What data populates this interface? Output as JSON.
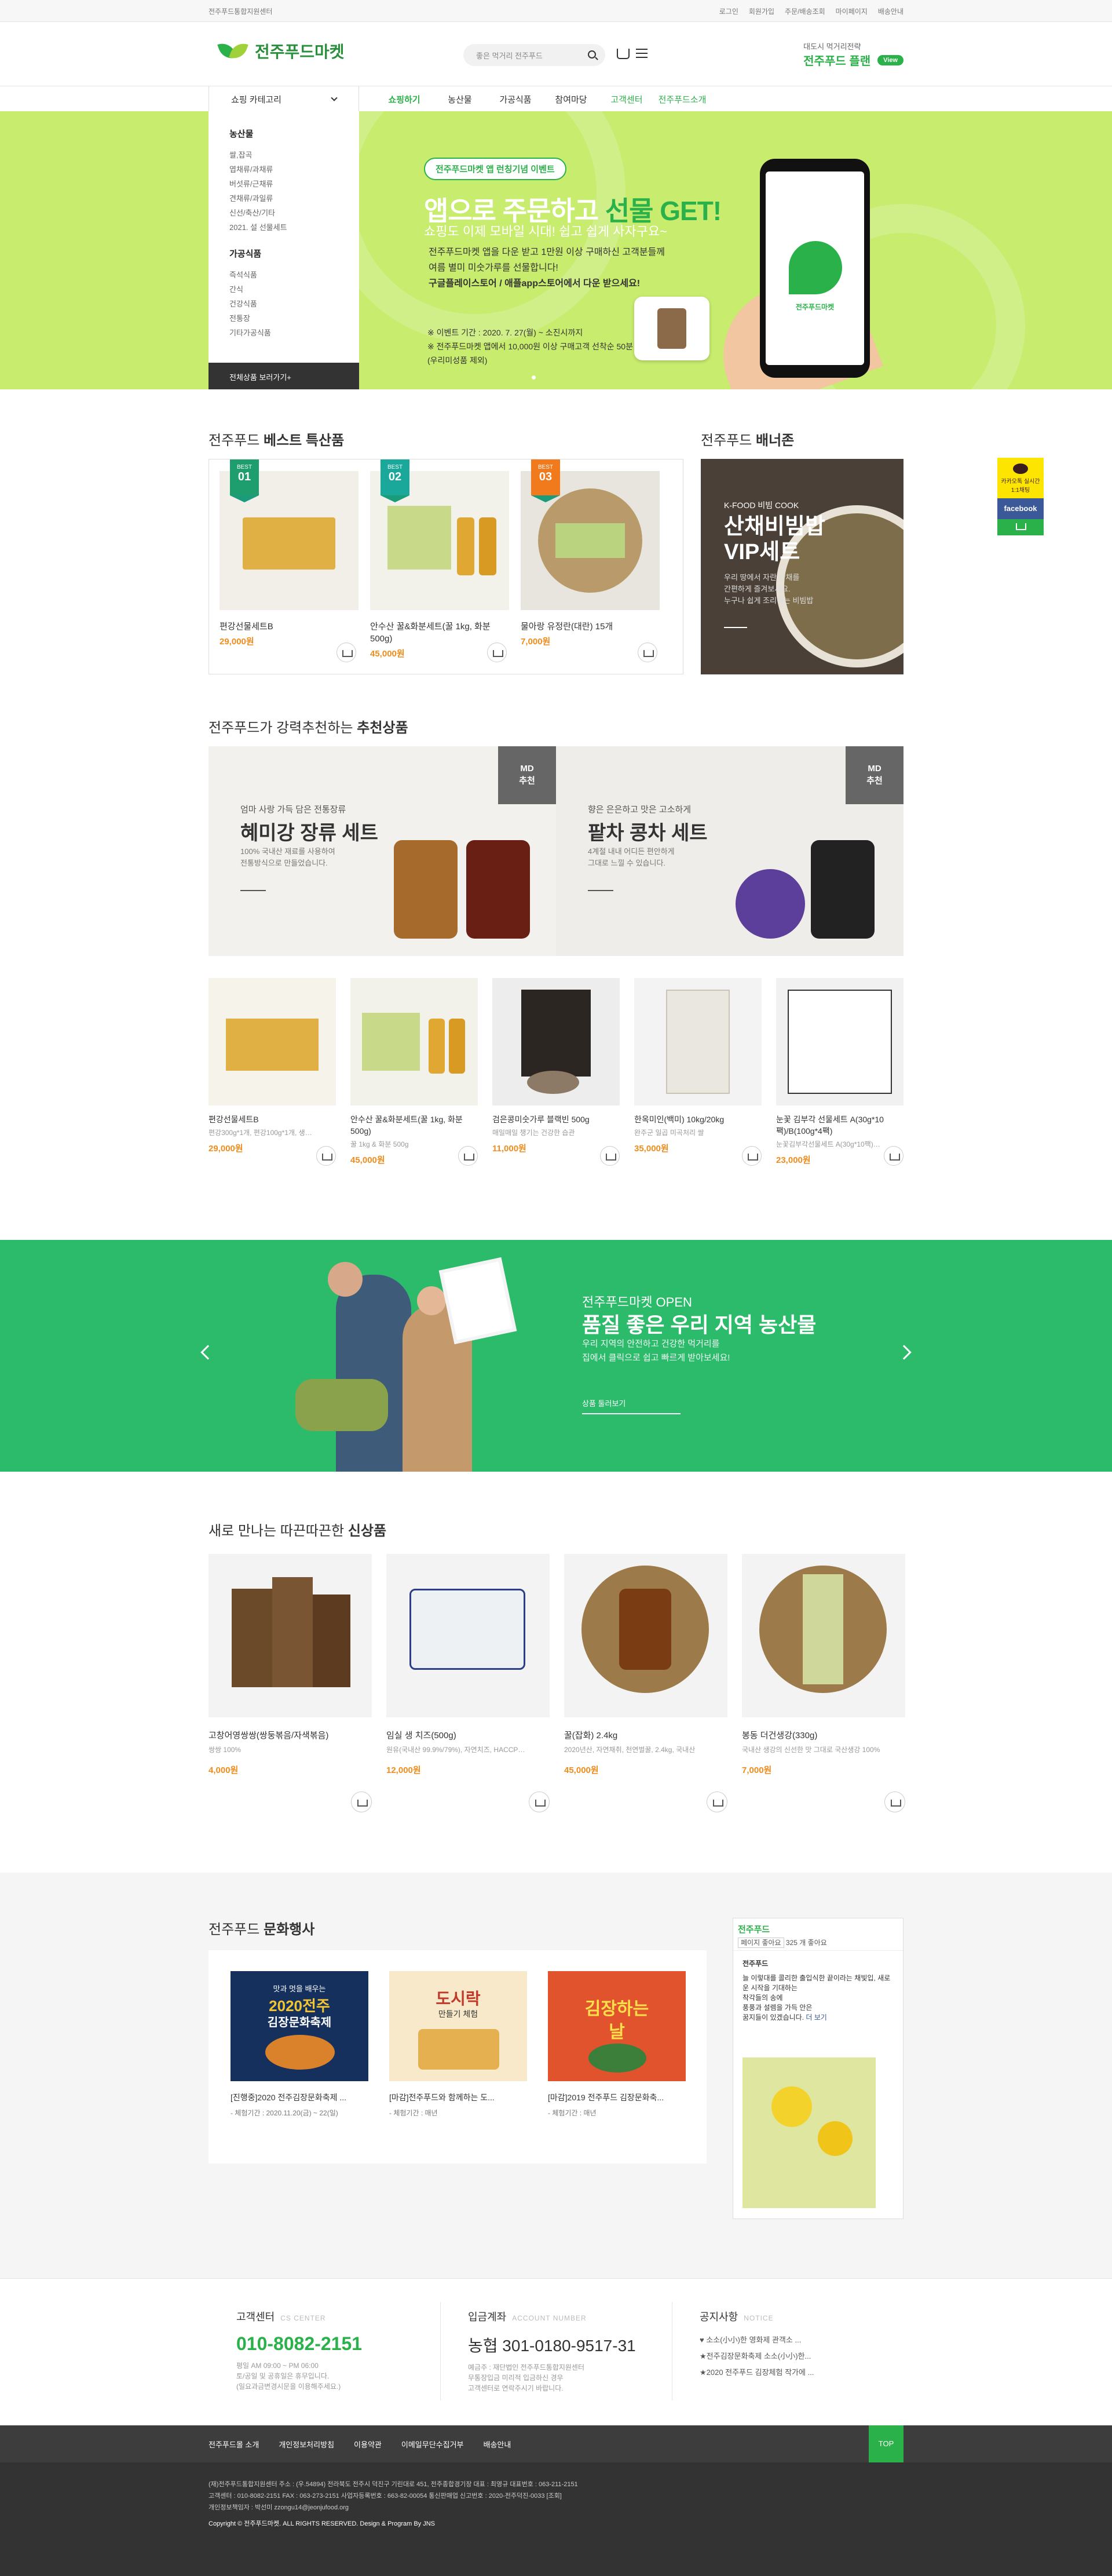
{
  "topbar": {
    "site_label": "전주푸드통합지원센터",
    "links": [
      "로그인",
      "회원가입",
      "주문/배송조회",
      "마이페이지",
      "배송안내"
    ]
  },
  "header": {
    "logo_text": "전주푸드마켓",
    "search_placeholder": "좋은 먹거리 전주푸드",
    "plan_small": "대도시 먹거리전략",
    "plan_big": "전주푸드 플랜",
    "plan_view": "View"
  },
  "gnb": {
    "category_button": "쇼핑 카테고리",
    "menu": [
      "쇼핑하기",
      "농산물",
      "가공식품",
      "참여마당",
      "고객센터",
      "전주푸드소개"
    ]
  },
  "category_panel": {
    "group1_title": "농산물",
    "group1_items": [
      "쌀,잡곡",
      "엽채류/과채류",
      "버섯류/근채류",
      "견채류/과일류",
      "신선/축산/기타",
      "2021. 설 선물세트"
    ],
    "group2_title": "가공식품",
    "group2_items": [
      "즉석식품",
      "간식",
      "건강식품",
      "전통장",
      "기타가공식품"
    ],
    "all_link": "전체상품 보러가기+"
  },
  "hero": {
    "badge": "전주푸드마켓 앱 런칭기념 이벤트",
    "title_a": "앱으로 주문하고",
    "title_b": "선물 GET!",
    "subtitle": "쇼핑도 이제 모바일 시대! 쉽고 쉽게 사자구요~",
    "body_1": "전주푸드마켓 앱을 다운 받고 1만원 이상 구매하신 고객분들께",
    "body_2": "여름 별미 미숫가루를 선물합니다!",
    "body_3": "구글플레이스토어 / 애플app스토어에서 다운 받으세요!",
    "note_1": "※ 이벤트 기간 : 2020. 7. 27(월) ~ 소진시까지",
    "note_2": "※ 전주푸드마켓 앱에서 10,000원 이상 구매고객 선착순 50분 한정",
    "note_3": "(우리미성품 제외)",
    "phone_brand": "전주푸드마켓"
  },
  "best": {
    "title_a": "전주푸드",
    "title_b": "베스트 특산품",
    "items": [
      {
        "rank_label": "BEST",
        "rank": "01",
        "name": "편강선물세트B",
        "price": "29,000원"
      },
      {
        "rank_label": "BEST",
        "rank": "02",
        "name": "안수산 꿀&화분세트(꿀 1kg, 화분 500g)",
        "price": "45,000원"
      },
      {
        "rank_label": "BEST",
        "rank": "03",
        "name": "물아랑 유정란(대란) 15개",
        "price": "7,000원"
      }
    ]
  },
  "banner_zone": {
    "title_a": "전주푸드",
    "title_b": "배너존",
    "small": "K-FOOD 비빔 COOK",
    "big_1": "산채비빔밥",
    "big_2": "VIP세트",
    "desc_1": "우리 땅에서 자란 산채를",
    "desc_2": "간편하게 즐겨보세요.",
    "desc_3": "누구나 쉽게 조리하는 비빔밥"
  },
  "recommend": {
    "title_a": "전주푸드가 강력추천하는",
    "title_b": "추천상품",
    "md": [
      {
        "tag_1": "MD",
        "tag_2": "추천",
        "small": "엄마 사랑 가득 담은 전통장류",
        "title": "혜미강 장류 세트",
        "desc_1": "100% 국내산 재료를 사용하여",
        "desc_2": "전통방식으로 만들었습니다."
      },
      {
        "tag_1": "MD",
        "tag_2": "추천",
        "small": "향은 은은하고 맛은 고소하게",
        "title": "팥차 콩차 세트",
        "desc_1": "4계절 내내 어디든 편안하게",
        "desc_2": "그대로 느낄 수 있습니다."
      }
    ],
    "items": [
      {
        "name": "편강선물세트B",
        "desc": "편강300g*1개, 편강100g*1개, 생강...",
        "price": "29,000원"
      },
      {
        "name": "안수산 꿀&화분세트(꿀 1kg, 화분 500g)",
        "desc": "꿀 1kg & 화분 500g",
        "price": "45,000원"
      },
      {
        "name": "검은콩미숫가루 블랙빈 500g",
        "desc": "매일매일 챙기는 건강한 습관",
        "price": "11,000원"
      },
      {
        "name": "한옥미인(백미) 10kg/20kg",
        "desc": "완주군 일곱 미곡처리 쌀",
        "price": "35,000원"
      },
      {
        "name": "눈꽃 김부각 선물세트 A(30g*10팩)/B(100g*4팩)",
        "desc": "눈꽃김부각선물세트 A(30g*10팩) / ...",
        "price": "23,000원"
      }
    ]
  },
  "green_banner": {
    "t1": "전주푸드마켓 OPEN",
    "t2": "품질 좋은 우리 지역 농산물",
    "t3a": "우리 지역의 안전하고 건강한 먹거리를",
    "t3b": "집에서 클릭으로 쉽고 빠르게 받아보세요!",
    "button": "상품 둘러보기"
  },
  "new_items": {
    "title_a": "새로 만나는 따끈따끈한",
    "title_b": "신상품",
    "items": [
      {
        "name": "고창어영쌍쌍(쌍둥볶음/자색볶음)",
        "desc": "쌍쌍 100%",
        "price": "4,000원"
      },
      {
        "name": "임실 생 치즈(500g)",
        "desc": "원유(국내산 99.9%/79%), 자연치즈, HACCP인증...",
        "price": "12,000원"
      },
      {
        "name": "꿀(잡화) 2.4kg",
        "desc": "2020년산, 자연채취, 천연벌꿀, 2.4kg, 국내산",
        "price": "45,000원"
      },
      {
        "name": "봉동 더건생강(330g)",
        "desc": "국내산 생강의 신선한 맛 그대로 국산생강 100%",
        "price": "7,000원"
      }
    ]
  },
  "culture": {
    "title_a": "전주푸드",
    "title_b": "문화행사",
    "items": [
      {
        "poster_1": "맛과 멋을 배우는",
        "poster_2": "2020전주",
        "poster_3": "김장문화축제",
        "name": "[진행중]2020 전주김장문화축제 ...",
        "date": "- 체험기간 : 2020.11.20(금) ~ 22(일)"
      },
      {
        "poster_1": "도시락",
        "poster_2": "만들기 체험",
        "poster_3": "",
        "name": "[마감]전주푸드와 함께하는 도...",
        "date": "- 체험기간 : 매년"
      },
      {
        "poster_1": "김장하는",
        "poster_2": "날",
        "poster_3": "",
        "name": "[마감]2019 전주푸드 김장문화축...",
        "date": "- 체험기간 : 매년"
      }
    ]
  },
  "facebook": {
    "page_name": "전주푸드",
    "like": "페이지 좋아요",
    "likes_count": "325 개 좋아요",
    "post_name": "전주푸드",
    "post_1": "늘 이렇대를 콜리한 출입식한 끝이라는 채빛입, 새로운 시작을 기대하는",
    "post_2": "착각들의 송에",
    "post_3": "풍풍과 설렘을 가득 안은",
    "post_4": "꿈지들이 있겠습니다.",
    "more": "더 보기"
  },
  "footer_info": {
    "cs_title": "고객센터",
    "cs_en": "CS CENTER",
    "cs_phone": "010-8082-2151",
    "cs_hours": "평일 AM 09:00 ~ PM 06:00",
    "cs_note_1": "토/공일 및 공휴일은 휴무입니다.",
    "cs_note_2": "(일요과금변경시문을 이용해주세요.)",
    "bank_title": "입금계좌",
    "bank_en": "ACCOUNT NUMBER",
    "bank_number": "농협 301-0180-9517-31",
    "bank_note_1": "예금주 : 재단법인 전주푸드통합지원센터",
    "bank_note_2": "무통장입금 미리적 입금하신 경우",
    "bank_note_3": "고객센터로 연락주시기 바랍니다.",
    "notice_title": "공지사항",
    "notice_en": "NOTICE",
    "notices": [
      "♥ 소소(小小)한 영화제 관객소 ...",
      "★전주김장문화축제 소소(小小)한...",
      "★2020 전주푸드 김장체험 작가에 ..."
    ]
  },
  "footer_nav": {
    "links": [
      "전주푸드몰 소개",
      "개인정보처리방침",
      "이용약관",
      "이메일무단수집거부",
      "배송안내"
    ],
    "top": "TOP"
  },
  "footer_bottom": {
    "line_1": "(재)전주푸드통합지원센터    주소 : (우.54894) 전라북도 전주시 덕진구 기린대로 451, 전주종합경기장    대표 : 최영규    대표번호 : 063-211-2151",
    "line_2": "고객센터 : 010-8082-2151    FAX : 063-273-2151    사업자등록번호 : 663-82-00054    통신판매업 신고번호 : 2020-전주덕진-0033 [조회]",
    "line_3": "개인정보책임자 : 박선미    zzongu14@jeonjufood.org",
    "copyright": "Copyright © 전주푸드마켓. ALL RIGHTS RESERVED. Design & Program By JNS"
  },
  "quick": {
    "kakao": "카카오톡 실시간 1:1채팅",
    "facebook": "facebook"
  },
  "colors": {
    "brand_green": "#2bb14a",
    "price_orange": "#f08c1c",
    "hero_lime": "#c7ec6e"
  }
}
